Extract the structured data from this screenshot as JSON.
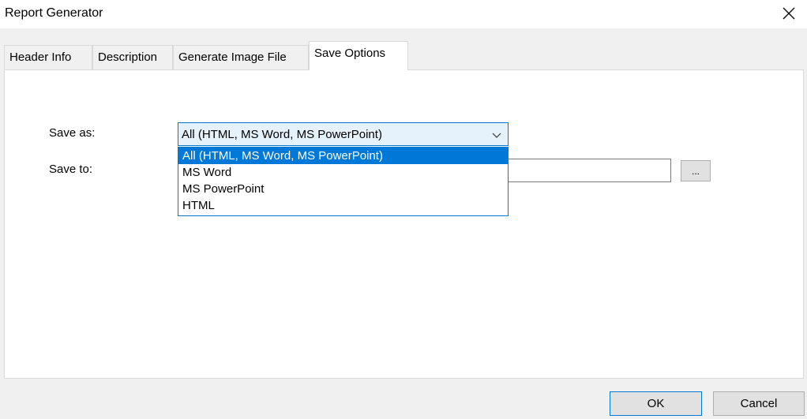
{
  "window": {
    "title": "Report Generator",
    "close_icon": "close-icon"
  },
  "tabs": [
    {
      "label": "Header Info",
      "active": false
    },
    {
      "label": "Description",
      "active": false
    },
    {
      "label": "Generate Image File",
      "active": false
    },
    {
      "label": "Save Options",
      "active": true
    }
  ],
  "save_options": {
    "save_as_label": "Save as:",
    "save_as_value": "All (HTML, MS Word, MS PowerPoint)",
    "options": [
      "All (HTML, MS Word, MS PowerPoint)",
      "MS Word",
      "MS PowerPoint",
      "HTML"
    ],
    "selected_index": 0,
    "save_to_label": "Save to:",
    "save_to_value": "",
    "browse_label": "..."
  },
  "buttons": {
    "ok": "OK",
    "cancel": "Cancel"
  },
  "colors": {
    "accent": "#0078d7",
    "window_bg": "#f0f0f0",
    "panel_bg": "#ffffff",
    "combo_bg": "#e5f1fb"
  }
}
